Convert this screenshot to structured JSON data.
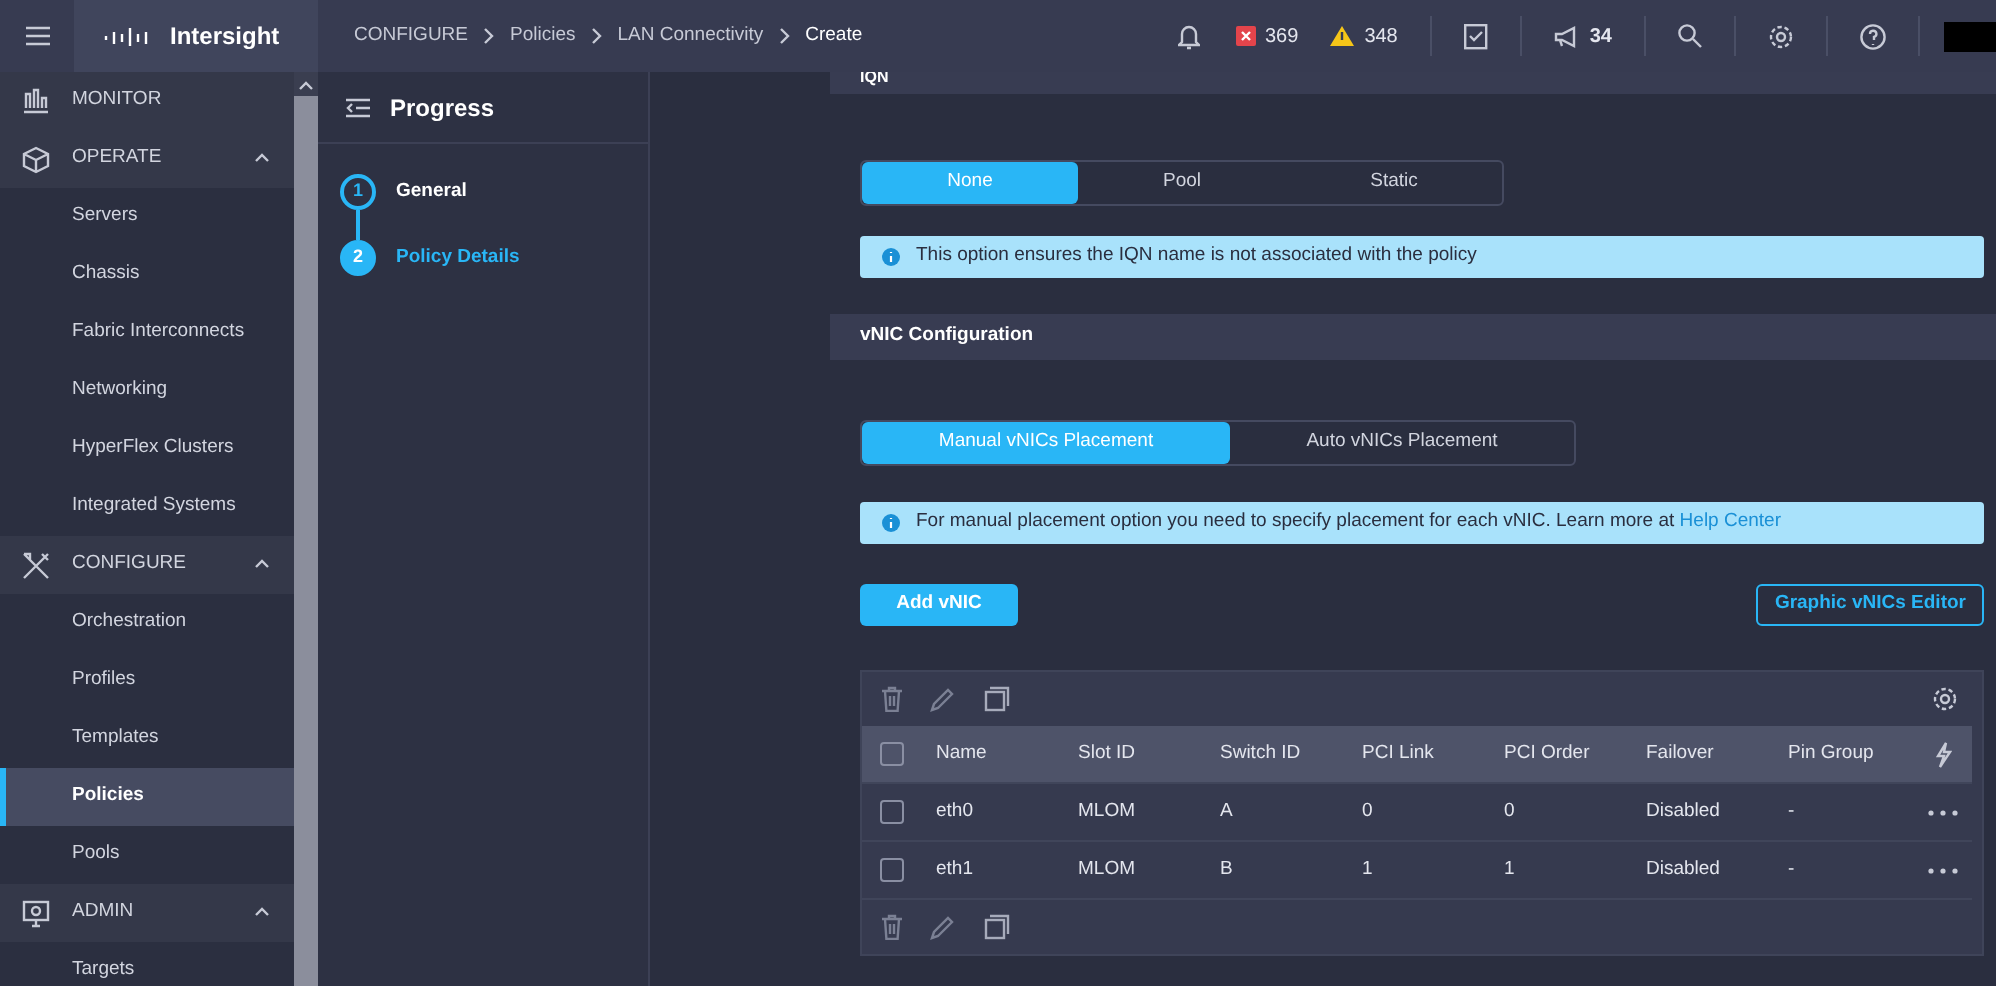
{
  "top_bar": {
    "brand": "Intersight",
    "breadcrumbs": [
      "CONFIGURE",
      "Policies",
      "LAN Connectivity",
      "Create"
    ],
    "alarms": {
      "critical": "369",
      "warning": "348"
    },
    "announcements": "34"
  },
  "sidebar": {
    "items": [
      {
        "kind": "section",
        "label": "MONITOR"
      },
      {
        "kind": "section",
        "label": "OPERATE",
        "expanded": true
      },
      {
        "kind": "item",
        "label": "Servers",
        "selected": false
      },
      {
        "kind": "item",
        "label": "Chassis",
        "selected": false
      },
      {
        "kind": "item",
        "label": "Fabric Interconnects",
        "selected": false
      },
      {
        "kind": "item",
        "label": "Networking",
        "selected": false
      },
      {
        "kind": "item",
        "label": "HyperFlex Clusters",
        "selected": false
      },
      {
        "kind": "item",
        "label": "Integrated Systems",
        "selected": false
      },
      {
        "kind": "section",
        "label": "CONFIGURE",
        "expanded": true
      },
      {
        "kind": "item",
        "label": "Orchestration",
        "selected": false
      },
      {
        "kind": "item",
        "label": "Profiles",
        "selected": false
      },
      {
        "kind": "item",
        "label": "Templates",
        "selected": false
      },
      {
        "kind": "item",
        "label": "Policies",
        "selected": true
      },
      {
        "kind": "item",
        "label": "Pools",
        "selected": false
      },
      {
        "kind": "section",
        "label": "ADMIN",
        "expanded": true
      },
      {
        "kind": "item",
        "label": "Targets",
        "selected": false
      }
    ]
  },
  "progress": {
    "title": "Progress",
    "steps": [
      {
        "number": "1",
        "label": "General",
        "selected": false
      },
      {
        "number": "2",
        "label": "Policy Details",
        "selected": true
      }
    ]
  },
  "iqn": {
    "title": "IQN",
    "options": [
      {
        "label": "None",
        "selected": true
      },
      {
        "label": "Pool",
        "selected": false
      },
      {
        "label": "Static",
        "selected": false
      }
    ],
    "info": "This option ensures the IQN name is not associated with the policy"
  },
  "vnic": {
    "title": "vNIC Configuration",
    "options": [
      {
        "label": "Manual vNICs Placement",
        "selected": true
      },
      {
        "label": "Auto vNICs Placement",
        "selected": false
      }
    ],
    "info": "For manual placement option you need to specify placement for each vNIC. Learn more at",
    "info_link": "Help Center",
    "add_button": "Add vNIC",
    "editor_button": "Graphic vNICs Editor"
  },
  "table": {
    "columns": [
      "Name",
      "Slot ID",
      "Switch ID",
      "PCI Link",
      "PCI Order",
      "Failover",
      "Pin Group"
    ],
    "all_checked": false,
    "rows": [
      {
        "checked": false,
        "cells": [
          "eth0",
          "MLOM",
          "A",
          "0",
          "0",
          "Disabled",
          "-"
        ]
      },
      {
        "checked": false,
        "cells": [
          "eth1",
          "MLOM",
          "B",
          "1",
          "1",
          "Disabled",
          "-"
        ]
      }
    ]
  }
}
